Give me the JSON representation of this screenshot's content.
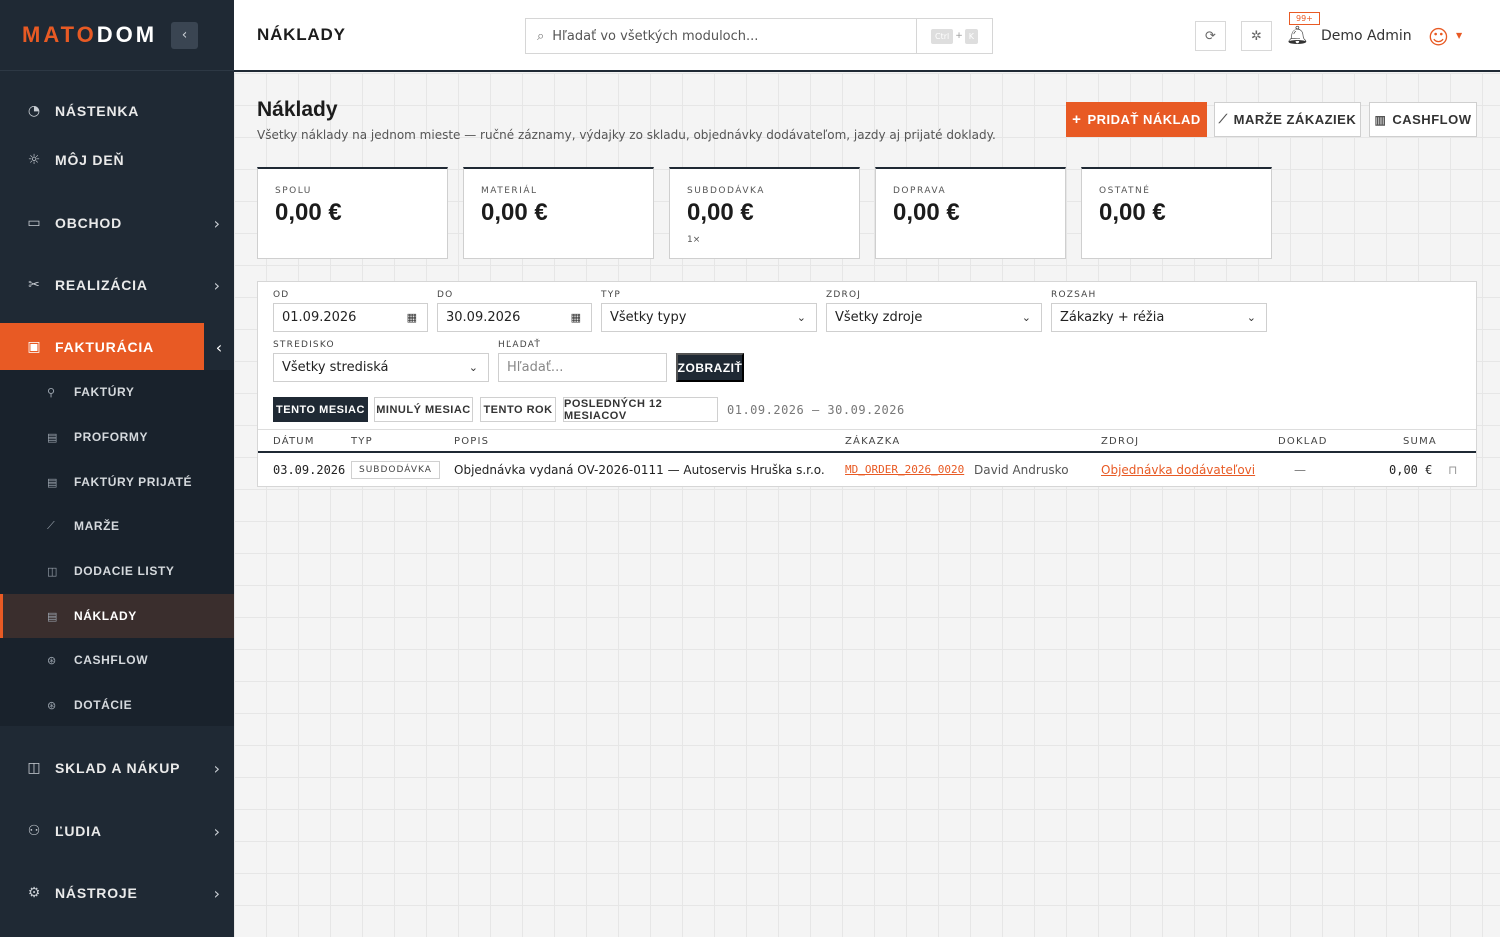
{
  "brand": {
    "part1": "MATO",
    "part2": "DOM",
    "collapse_icon": "chevron-left-icon"
  },
  "sidebar": {
    "items": [
      {
        "key": "nastenka",
        "label": "NÁSTENKA",
        "icon": "dashboard-icon"
      },
      {
        "key": "moj-den",
        "label": "MÔJ DEŇ",
        "icon": "sun-icon"
      },
      {
        "key": "obchod",
        "label": "OBCHOD",
        "icon": "briefcase-icon"
      },
      {
        "key": "realizacia",
        "label": "REALIZÁCIA",
        "icon": "tools-icon"
      },
      {
        "key": "fakturacia",
        "label": "FAKTURÁCIA",
        "icon": "invoice-icon"
      },
      {
        "key": "sklad",
        "label": "SKLAD A NÁKUP",
        "icon": "box-icon"
      },
      {
        "key": "ludia",
        "label": "ĽUDIA",
        "icon": "people-icon"
      },
      {
        "key": "nastroje",
        "label": "NÁSTROJE",
        "icon": "gear-icon"
      }
    ],
    "submenu": [
      {
        "label": "FAKTÚRY",
        "icon": "link-icon"
      },
      {
        "label": "PROFORMY",
        "icon": "document-icon"
      },
      {
        "label": "FAKTÚRY PRIJATÉ",
        "icon": "document-icon"
      },
      {
        "label": "MARŽE",
        "icon": "chart-icon"
      },
      {
        "label": "DODACIE LISTY",
        "icon": "box-icon"
      },
      {
        "label": "NÁKLADY",
        "icon": "document-icon"
      },
      {
        "label": "CASHFLOW",
        "icon": "cash-icon"
      },
      {
        "label": "DOTÁCIE",
        "icon": "cash-icon"
      }
    ]
  },
  "topbar": {
    "title": "NÁKLADY",
    "search_placeholder": "Hľadať vo všetkých moduloch...",
    "kbd_ctrl": "Ctrl",
    "kbd_plus": "+",
    "kbd_k": "K",
    "notifications": "99+",
    "user": "Demo Admin"
  },
  "page": {
    "title": "Náklady",
    "subtitle": "Všetky náklady na jednom mieste — ručné záznamy, výdajky zo skladu, objednávky dodávateľom, jazdy aj prijaté doklady.",
    "add_button": "PRIDAŤ NÁKLAD",
    "margins_button": "MARŽE ZÁKAZIEK",
    "cashflow_button": "CASHFLOW"
  },
  "stats": [
    {
      "label": "SPOLU",
      "value": "0,00 €",
      "note": ""
    },
    {
      "label": "MATERIÁL",
      "value": "0,00 €",
      "note": ""
    },
    {
      "label": "SUBDODÁVKA",
      "value": "0,00 €",
      "note": "1×"
    },
    {
      "label": "DOPRAVA",
      "value": "0,00 €",
      "note": ""
    },
    {
      "label": "OSTATNÉ",
      "value": "0,00 €",
      "note": ""
    }
  ],
  "filters": {
    "od_label": "OD",
    "od_value": "01.09.2026",
    "do_label": "DO",
    "do_value": "30.09.2026",
    "typ_label": "TYP",
    "typ_value": "Všetky typy",
    "zdroj_label": "ZDROJ",
    "zdroj_value": "Všetky zdroje",
    "rozsah_label": "ROZSAH",
    "rozsah_value": "Zákazky + réžia",
    "stredisko_label": "STREDISKO",
    "stredisko_value": "Všetky strediská",
    "hladat_label": "HĽADAŤ",
    "hladat_placeholder": "Hľadať...",
    "submit": "ZOBRAZIŤ",
    "presets": [
      "TENTO MESIAC",
      "MINULÝ MESIAC",
      "TENTO ROK",
      "POSLEDNÝCH 12 MESIACOV"
    ],
    "range_text": "01.09.2026 – 30.09.2026"
  },
  "table": {
    "headers": {
      "date": "DÁTUM",
      "type": "TYP",
      "desc": "POPIS",
      "order": "ZÁKAZKA",
      "source": "ZDROJ",
      "doc": "DOKLAD",
      "sum": "SUMA"
    },
    "rows": [
      {
        "date": "03.09.2026",
        "type": "SUBDODÁVKA",
        "desc": "Objednávka vydaná OV-2026-0111 — Autoservis Hruška s.r.o.",
        "order_code": "MD_ORDER_2026_0020",
        "order_name": "David Andrusko",
        "source": "Objednávka dodávateľovi",
        "doc": "—",
        "sum": "0,00 €"
      }
    ]
  },
  "colors": {
    "accent": "#e85a24",
    "dark": "#1f2934"
  }
}
